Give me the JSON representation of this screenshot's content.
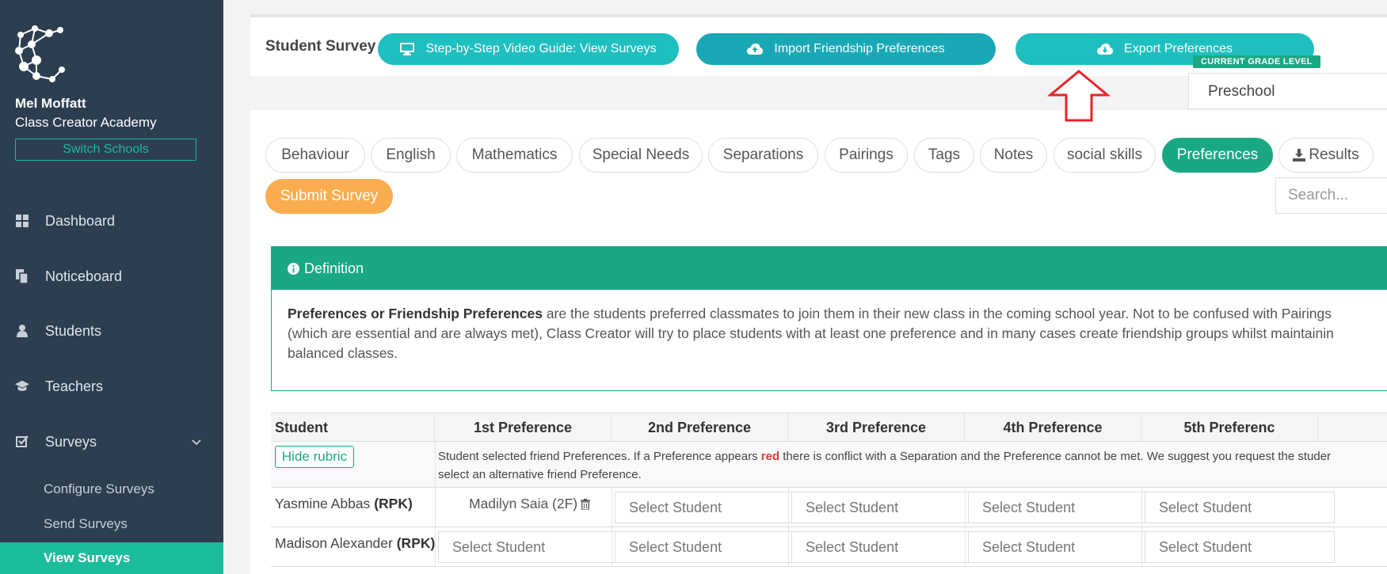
{
  "sidebar": {
    "user_name": "Mel Moffatt",
    "school_name": "Class Creator Academy",
    "switch_label": "Switch Schools",
    "nav": [
      {
        "label": "Dashboard",
        "icon": "grid-icon"
      },
      {
        "label": "Noticeboard",
        "icon": "copy-icon"
      },
      {
        "label": "Students",
        "icon": "user-icon"
      },
      {
        "label": "Teachers",
        "icon": "graduation-cap-icon"
      },
      {
        "label": "Surveys",
        "icon": "check-square-icon"
      }
    ],
    "sub_nav": [
      "Configure Surveys",
      "Send Surveys",
      "View Surveys"
    ]
  },
  "topbar": {
    "title": "Student Survey",
    "video_guide_label": "Step-by-Step Video Guide: View Surveys",
    "import_label": "Import Friendship Preferences",
    "export_label": "Export Preferences",
    "grade_badge": "CURRENT GRADE LEVEL",
    "grade_value": "Preschool"
  },
  "tabs": [
    "Behaviour",
    "English",
    "Mathematics",
    "Special Needs",
    "Separations",
    "Pairings",
    "Tags",
    "Notes",
    "social skills",
    "Preferences",
    "Results"
  ],
  "active_tab": "Preferences",
  "submit_label": "Submit Survey",
  "search_placeholder": "Search...",
  "definition": {
    "header": "Definition",
    "term": "Preferences or Friendship Preferences",
    "line1": " are the students preferred classmates to join them in their new class in the coming school year. Not to be confused with Pairings",
    "line2": "(which are essential and are always met), Class Creator will try to place students with at least one preference and in many cases create friendship groups whilst maintainin",
    "line3": "balanced classes."
  },
  "table": {
    "headers": [
      "Student",
      "1st Preference",
      "2nd Preference",
      "3rd Preference",
      "4th Preference",
      "5th Preferenc"
    ],
    "hide_rubric_label": "Hide rubric",
    "rubric_part1": "Student selected friend Preferences. If a Preference appears ",
    "rubric_red": "red",
    "rubric_part2": " there is conflict with a Separation and the Preference cannot be met. We suggest you request the studer",
    "rubric_line2": "select an alternative friend Preference.",
    "select_placeholder": "Select Student",
    "rows": [
      {
        "name": "Yasmine Abbas",
        "class": "(RPK)",
        "first_pref": "Madilyn Saia (2F)"
      },
      {
        "name": "Madison Alexander",
        "class": "(RPK)",
        "first_pref": ""
      }
    ]
  }
}
